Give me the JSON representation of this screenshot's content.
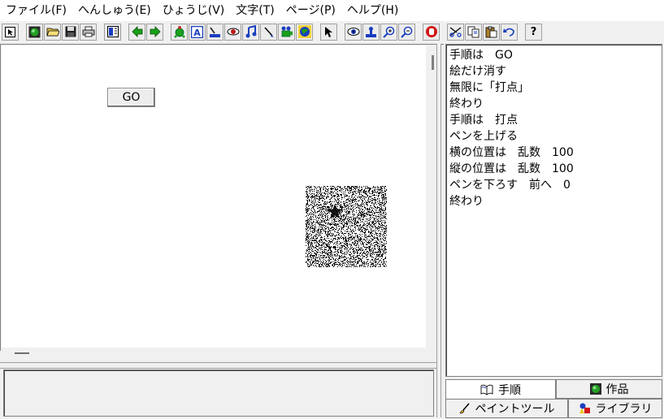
{
  "menu": [
    {
      "label": "ファイル(F)"
    },
    {
      "label": "へんしゅう(E)"
    },
    {
      "label": "ひょうじ(V)"
    },
    {
      "label": "文字(T)"
    },
    {
      "label": "ページ(P)"
    },
    {
      "label": "ヘルプ(H)"
    }
  ],
  "toolbar": {
    "help_label": "?"
  },
  "canvas": {
    "go_button_label": "GO"
  },
  "editor": {
    "lines": [
      "手順は　GO",
      "絵だけ消す",
      "無限に「打点」",
      "終わり",
      "手順は　打点",
      "ペンを上げる",
      "横の位置は　乱数　100",
      "縦の位置は　乱数　100",
      "ペンを下ろす　前へ　0",
      "終わり"
    ]
  },
  "tabs": {
    "procedure": "手順",
    "works": "作品",
    "paint_tool": "ペイントツール",
    "library": "ライブラリ"
  },
  "colors": {
    "window_bg": "#f0f0f0",
    "canvas_bg": "#ffffff",
    "tool_green": "#1aa01a",
    "tool_blue": "#1a3ec0",
    "tool_red": "#d01818"
  }
}
